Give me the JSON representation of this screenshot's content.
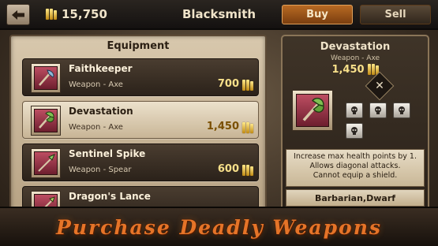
{
  "header": {
    "gold": "15,750",
    "title": "Blacksmith",
    "buy_label": "Buy",
    "sell_label": "Sell",
    "back_icon": "back-arrow-icon",
    "gold_icon": "gold-bars-icon"
  },
  "equipment": {
    "title": "Equipment",
    "items": [
      {
        "name": "Faithkeeper",
        "type": "Weapon - Axe",
        "price": "700",
        "icon": "axe-icon",
        "selected": false
      },
      {
        "name": "Devastation",
        "type": "Weapon - Axe",
        "price": "1,450",
        "icon": "double-axe-icon",
        "selected": true
      },
      {
        "name": "Sentinel Spike",
        "type": "Weapon - Spear",
        "price": "600",
        "icon": "spear-icon",
        "selected": false
      },
      {
        "name": "Dragon's Lance",
        "type": "",
        "price": "",
        "icon": "lance-icon",
        "selected": false
      }
    ]
  },
  "detail": {
    "name": "Devastation",
    "type": "Weapon - Axe",
    "price": "1,450",
    "icon": "double-axe-icon",
    "class_icon": "crossed-swords-icon",
    "skull_icons": [
      "skull-icon",
      "skull-icon",
      "skull-icon",
      "skull-icon"
    ],
    "description": "Increase max health points by 1.\nAllows diagonal attacks.\nCannot equip a shield.",
    "classes": "Barbarian,Dwarf"
  },
  "banner": {
    "text": "Purchase Deadly Weapons"
  },
  "colors": {
    "accent": "#b86a23",
    "gold_text": "#f8e08a",
    "banner_text": "#e57428"
  }
}
